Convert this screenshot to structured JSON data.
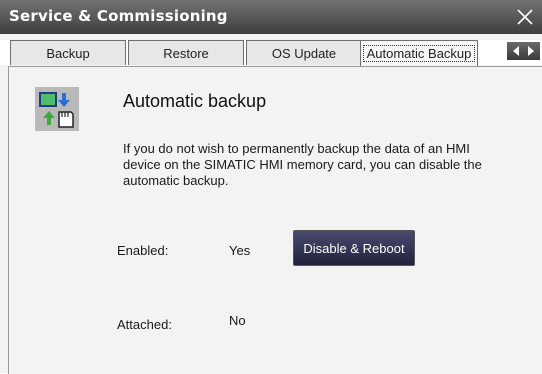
{
  "window": {
    "title": "Service & Commissioning",
    "close_icon": "close-icon"
  },
  "tabs": [
    {
      "label": "Backup",
      "active": false
    },
    {
      "label": "Restore",
      "active": false
    },
    {
      "label": "OS Update",
      "active": false
    },
    {
      "label": "Automatic Backup",
      "active": true
    }
  ],
  "tab_scroll": {
    "left_icon": "arrow-left-icon",
    "right_icon": "arrow-right-icon"
  },
  "page": {
    "icon": "automatic-backup-icon",
    "heading": "Automatic backup",
    "description": "If you do not wish to permanently backup the data of an HMI device on the SIMATIC HMI memory card, you can disable the automatic backup.",
    "enabled_label": "Enabled:",
    "enabled_value": "Yes",
    "attached_label": "Attached:",
    "attached_value": "No",
    "disable_button_label": "Disable & Reboot"
  },
  "colors": {
    "titlebar": "#4f4f4f",
    "button": "#2d2d4a",
    "accent_blue": "#2a6fd6",
    "accent_green": "#3faa3a"
  }
}
